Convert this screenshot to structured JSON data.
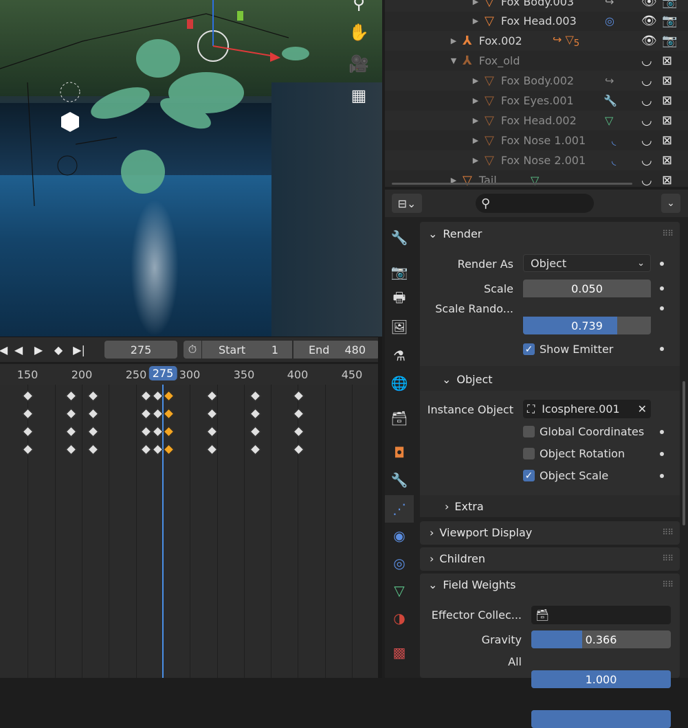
{
  "outliner": {
    "items": [
      {
        "name": "Fox Body.003",
        "indent": 2,
        "extra": "↪"
      },
      {
        "name": "Fox Head.003",
        "indent": 2,
        "extra": "◎"
      },
      {
        "name": "Fox.002",
        "indent": 1,
        "extra": "↪ ▽",
        "sub": "5"
      },
      {
        "name": "Fox_old",
        "indent": 1,
        "extra": ""
      },
      {
        "name": "Fox Body.002",
        "indent": 2,
        "extra": "↪"
      },
      {
        "name": "Fox Eyes.001",
        "indent": 2,
        "extra": "🔧"
      },
      {
        "name": "Fox Head.002",
        "indent": 2,
        "extra": "▽"
      },
      {
        "name": "Fox Nose 1.001",
        "indent": 2,
        "extra": "◟"
      },
      {
        "name": "Fox Nose 2.001",
        "indent": 2,
        "extra": "◟"
      },
      {
        "name": "Tail",
        "indent": 1,
        "extra": "▽"
      }
    ]
  },
  "timeline": {
    "current_frame": "275",
    "start_label": "Start",
    "start_value": "1",
    "end_label": "End",
    "end_value": "480",
    "ruler": [
      "150",
      "200",
      "250",
      "275",
      "300",
      "350",
      "400",
      "450"
    ]
  },
  "properties": {
    "render": {
      "title": "Render",
      "render_as_label": "Render As",
      "render_as_value": "Object",
      "scale_label": "Scale",
      "scale_value": "0.050",
      "scale_random_label": "Scale Rando...",
      "scale_random_value": "0.739",
      "scale_random_fraction": 0.739,
      "show_emitter_label": "Show Emitter",
      "show_emitter": true
    },
    "object": {
      "title": "Object",
      "instance_object_label": "Instance Object",
      "instance_object_value": "Icosphere.001",
      "global_coordinates_label": "Global Coordinates",
      "global_coordinates": false,
      "object_rotation_label": "Object Rotation",
      "object_rotation": false,
      "object_scale_label": "Object Scale",
      "object_scale": true
    },
    "extra_title": "Extra",
    "viewport_display_title": "Viewport Display",
    "children_title": "Children",
    "field_weights": {
      "title": "Field Weights",
      "effector_label": "Effector Collec...",
      "gravity_label": "Gravity",
      "gravity_value": "0.366",
      "gravity_fraction": 0.366,
      "all_label": "All",
      "all_value": "1.000",
      "all_fraction": 1.0
    }
  }
}
